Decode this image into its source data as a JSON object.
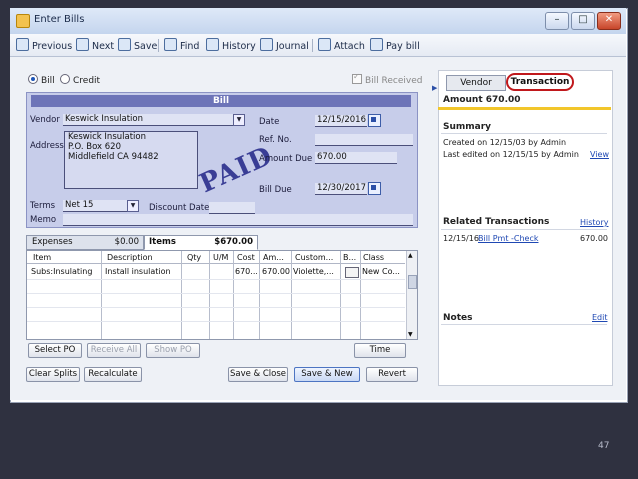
{
  "window": {
    "title": "Enter Bills"
  },
  "toolbar": {
    "previous": "Previous",
    "next": "Next",
    "save": "Save",
    "find": "Find",
    "history": "History",
    "journal": "Journal",
    "attach": "Attach",
    "pay_bill": "Pay bill"
  },
  "mode": {
    "bill": "Bill",
    "credit": "Credit",
    "bill_received": "Bill Received"
  },
  "form": {
    "header": "Bill",
    "vendor_label": "Vendor",
    "vendor_value": "Keswick Insulation",
    "address_label": "Address",
    "address_lines": [
      "Keswick Insulation",
      "P.O. Box 620",
      "Middlefield CA 94482"
    ],
    "date_label": "Date",
    "date_value": "12/15/2016",
    "ref_label": "Ref. No.",
    "ref_value": "",
    "amount_due_label": "Amount Due",
    "amount_due_value": "670.00",
    "bill_due_label": "Bill Due",
    "bill_due_value": "12/30/2017",
    "terms_label": "Terms",
    "terms_value": "Net 15",
    "discount_date_label": "Discount Date",
    "memo_label": "Memo",
    "stamp": "PAID"
  },
  "tabs": {
    "expenses_label": "Expenses",
    "expenses_amount": "$0.00",
    "items_label": "Items",
    "items_amount": "$670.00"
  },
  "grid": {
    "headers": [
      "Item",
      "Description",
      "Qty",
      "U/M",
      "Cost",
      "Am...",
      "Custom...",
      "B...",
      "Class"
    ],
    "rows": [
      [
        "Subs:Insulating",
        "Install insulation",
        "",
        "",
        "670....",
        "670.00",
        "Violette,...",
        "",
        "New Co..."
      ]
    ]
  },
  "buttons": {
    "select_po": "Select PO",
    "receive_all": "Receive All",
    "show_po": "Show PO",
    "time": "Time",
    "clear_splits": "Clear Splits",
    "recalculate": "Recalculate",
    "save_close": "Save & Close",
    "save_new": "Save & New",
    "revert": "Revert"
  },
  "side": {
    "tab_vendor": "Vendor",
    "tab_transaction": "Transaction",
    "amount": "Amount 670.00",
    "summary_title": "Summary",
    "created": "Created on 12/15/03  by  Admin",
    "edited": "Last edited on 12/15/15 by Admin",
    "view_link": "View",
    "related_title": "Related Transactions",
    "history_link": "History",
    "related_date": "12/15/16",
    "related_link": "Bill Pmt -Check",
    "related_amount": "670.00",
    "notes_title": "Notes",
    "edit_link": "Edit"
  },
  "slide": {
    "page_number": "47"
  },
  "colors": {
    "form_bg": "#c7cdea",
    "accent_red": "#c0181c",
    "rule_yellow": "#f2c62a"
  }
}
